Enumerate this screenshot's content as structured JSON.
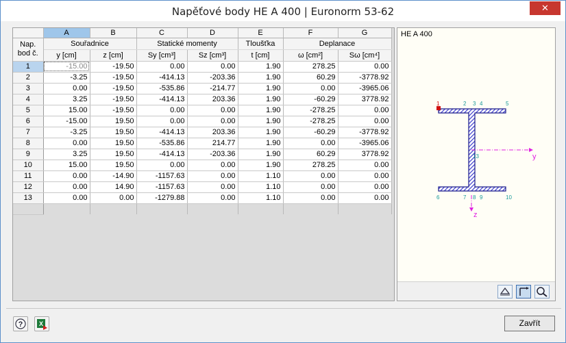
{
  "window": {
    "title": "Napěťové body HE A 400 | Euronorm 53-62",
    "close_glyph": "✕"
  },
  "table": {
    "col_letters": [
      "A",
      "B",
      "C",
      "D",
      "E",
      "F",
      "G"
    ],
    "row_header_label": "Nap. bod č.",
    "groups": {
      "coords": "Souřadnice",
      "static": "Statické momenty",
      "thickness": "Tloušťka",
      "warping": "Deplanace"
    },
    "units": [
      "y [cm]",
      "z [cm]",
      "Sy [cm³]",
      "Sz [cm³]",
      "t [cm]",
      "ω [cm²]",
      "Sω [cm⁴]"
    ],
    "rows": [
      {
        "no": "1",
        "cells": [
          "-15.00",
          "-19.50",
          "0.00",
          "0.00",
          "1.90",
          "278.25",
          "0.00"
        ]
      },
      {
        "no": "2",
        "cells": [
          "-3.25",
          "-19.50",
          "-414.13",
          "-203.36",
          "1.90",
          "60.29",
          "-3778.92"
        ]
      },
      {
        "no": "3",
        "cells": [
          "0.00",
          "-19.50",
          "-535.86",
          "-214.77",
          "1.90",
          "0.00",
          "-3965.06"
        ]
      },
      {
        "no": "4",
        "cells": [
          "3.25",
          "-19.50",
          "-414.13",
          "203.36",
          "1.90",
          "-60.29",
          "3778.92"
        ]
      },
      {
        "no": "5",
        "cells": [
          "15.00",
          "-19.50",
          "0.00",
          "0.00",
          "1.90",
          "-278.25",
          "0.00"
        ]
      },
      {
        "no": "6",
        "cells": [
          "-15.00",
          "19.50",
          "0.00",
          "0.00",
          "1.90",
          "-278.25",
          "0.00"
        ]
      },
      {
        "no": "7",
        "cells": [
          "-3.25",
          "19.50",
          "-414.13",
          "203.36",
          "1.90",
          "-60.29",
          "-3778.92"
        ]
      },
      {
        "no": "8",
        "cells": [
          "0.00",
          "19.50",
          "-535.86",
          "214.77",
          "1.90",
          "0.00",
          "-3965.06"
        ]
      },
      {
        "no": "9",
        "cells": [
          "3.25",
          "19.50",
          "-414.13",
          "-203.36",
          "1.90",
          "60.29",
          "3778.92"
        ]
      },
      {
        "no": "10",
        "cells": [
          "15.00",
          "19.50",
          "0.00",
          "0.00",
          "1.90",
          "278.25",
          "0.00"
        ]
      },
      {
        "no": "11",
        "cells": [
          "0.00",
          "-14.90",
          "-1157.63",
          "0.00",
          "1.10",
          "0.00",
          "0.00"
        ]
      },
      {
        "no": "12",
        "cells": [
          "0.00",
          "14.90",
          "-1157.63",
          "0.00",
          "1.10",
          "0.00",
          "0.00"
        ]
      },
      {
        "no": "13",
        "cells": [
          "0.00",
          "0.00",
          "-1279.88",
          "0.00",
          "1.10",
          "0.00",
          "0.00"
        ]
      }
    ]
  },
  "preview": {
    "title": "HE A 400",
    "point_labels": [
      "1",
      "2",
      "3",
      "4",
      "5",
      "6",
      "7",
      "8",
      "9",
      "10",
      "13"
    ],
    "axis_y": "y",
    "axis_z": "z",
    "colors": {
      "section_fill": "#3a3acb",
      "point_label": "#1a9a9a",
      "axis": "#e020e0",
      "selected_point": "#d01010"
    },
    "toolbar_icons": [
      "section-view-icon",
      "axis-view-icon",
      "zoom-reset-icon"
    ]
  },
  "footer": {
    "icons": [
      "help-icon",
      "excel-export-icon"
    ],
    "close_label": "Zavřít"
  }
}
